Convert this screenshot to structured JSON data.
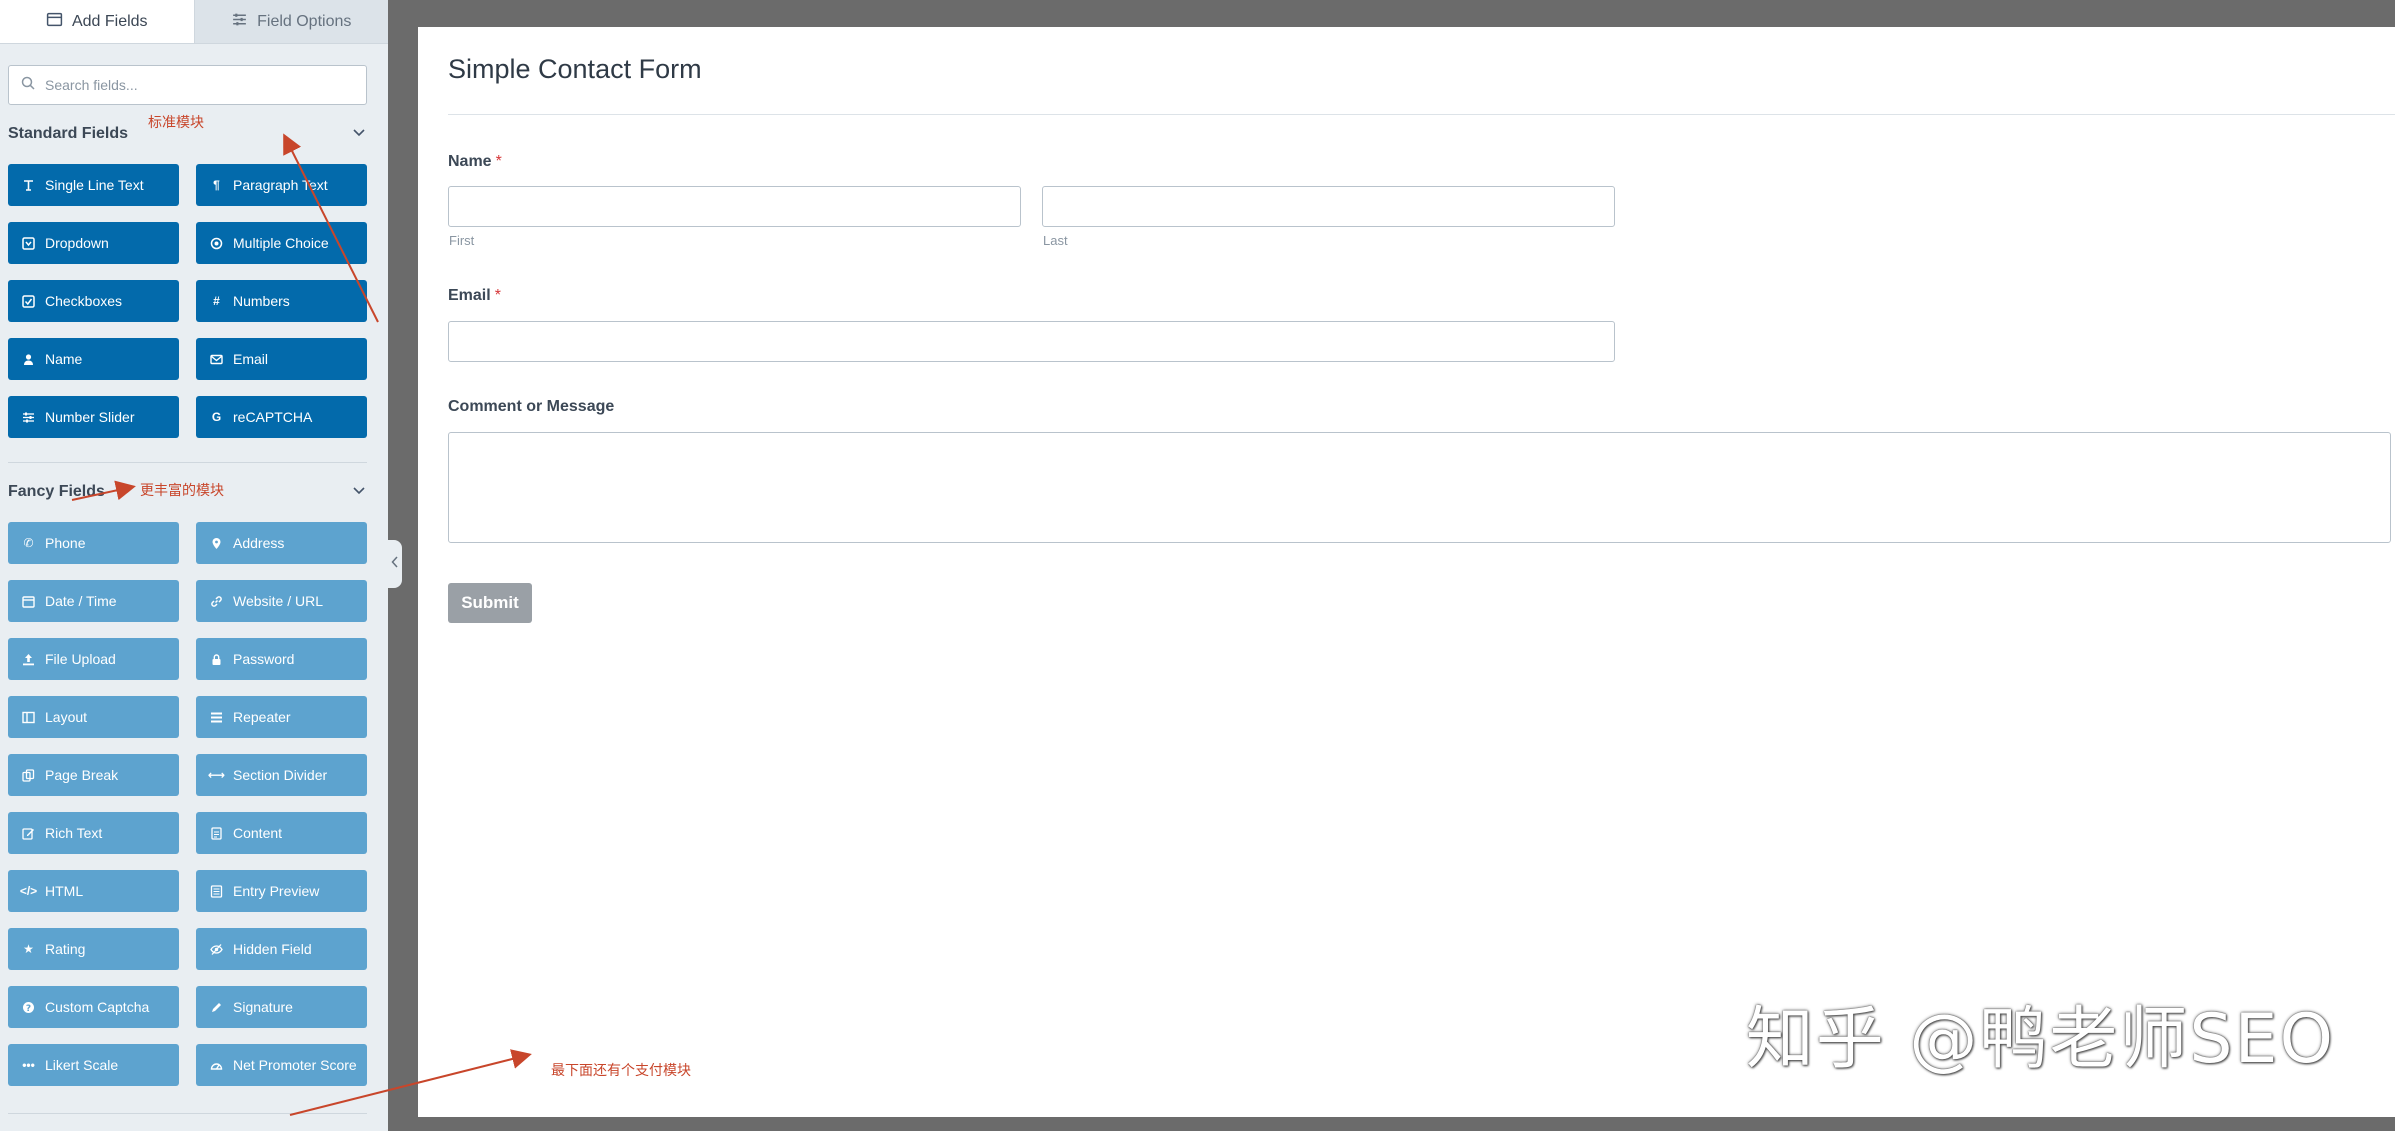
{
  "tabs": {
    "add_fields": "Add Fields",
    "field_options": "Field Options"
  },
  "search": {
    "placeholder": "Search fields..."
  },
  "standard": {
    "title": "Standard Fields",
    "buttons": [
      "Single Line Text",
      "Paragraph Text",
      "Dropdown",
      "Multiple Choice",
      "Checkboxes",
      "Numbers",
      "Name",
      "Email",
      "Number Slider",
      "reCAPTCHA"
    ]
  },
  "fancy": {
    "title": "Fancy Fields",
    "buttons": [
      "Phone",
      "Address",
      "Date / Time",
      "Website / URL",
      "File Upload",
      "Password",
      "Layout",
      "Repeater",
      "Page Break",
      "Section Divider",
      "Rich Text",
      "Content",
      "HTML",
      "Entry Preview",
      "Rating",
      "Hidden Field",
      "Custom Captcha",
      "Signature",
      "Likert Scale",
      "Net Promoter Score"
    ]
  },
  "annotations": {
    "standard": "标准模块",
    "fancy": "更丰富的模块",
    "payment": "最下面还有个支付模块"
  },
  "form": {
    "title": "Simple Contact Form",
    "name_label": "Name",
    "required_mark": "*",
    "first_sublabel": "First",
    "last_sublabel": "Last",
    "email_label": "Email",
    "comment_label": "Comment or Message",
    "submit": "Submit"
  },
  "watermark": "知乎 @鸭老师SEO",
  "colors": {
    "standard_button": "#036aab",
    "fancy_button": "#5da3cf",
    "annotation": "#c8462b",
    "submit": "#9aa0a6"
  }
}
